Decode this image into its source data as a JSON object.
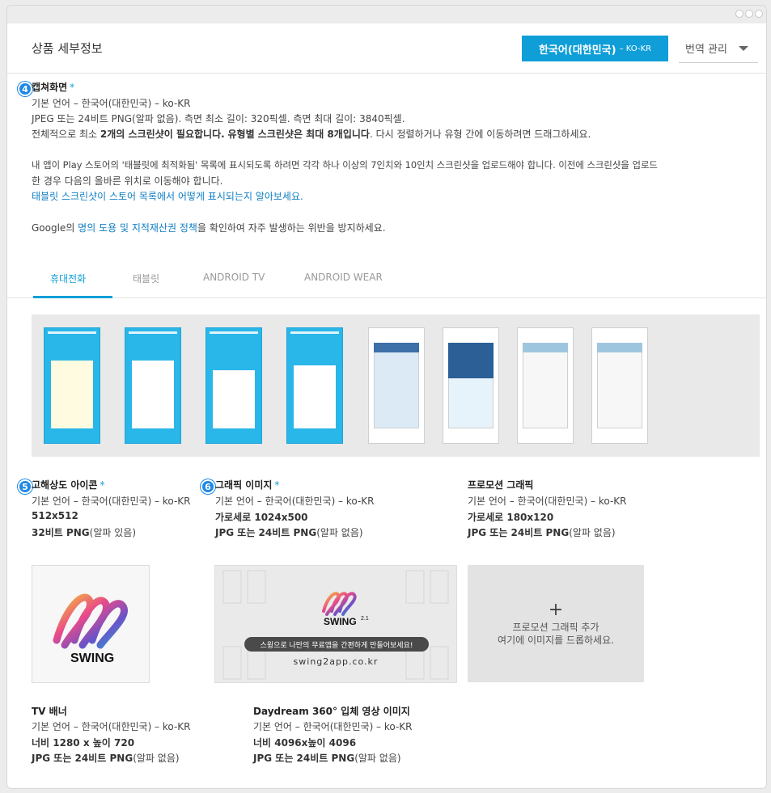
{
  "window": {
    "controls": [
      "dot-1",
      "dot-2",
      "dot-3"
    ]
  },
  "header": {
    "title": "상품 세부정보",
    "language_button": {
      "label": "한국어(대한민국)",
      "code": "– KO-KR"
    },
    "translate_label": "번역 관리"
  },
  "screenshots": {
    "badge": "4",
    "title": "캡쳐화면",
    "required_mark": "*",
    "default_lang": "기본 언어 – 한국어(대한민국) – ko-KR",
    "format": "JPEG 또는 24비트 PNG(알파 없음). 측면 최소 길이: 320픽셀. 측면 최대 길이: 3840픽셀.",
    "rule_prefix": "전체적으로 최소 ",
    "rule_bold1": "2개의 스크린샷이 필요합니다.",
    "rule_mid": " ",
    "rule_bold2": "유형별 스크린샷은 최대 8개입니다",
    "rule_suffix": ". 다시 정렬하거나 유형 간에 이동하려면 드래그하세요.",
    "tablet_p1": "내 앱이 Play 스토어의 '태블릿에 최적화됨' 목록에 표시되도록 하려면 각각 하나 이상의 7인치와 10인치 스크린샷을 업로드해야 합니다. 이전에 스크린샷을 업로드",
    "tablet_p2": "한 경우 다음의 올바른 위치로 이동해야 합니다.",
    "tablet_link": "태블릿 스크린샷이 스토어 목록에서 어떻게 표시되는지 알아보세요.",
    "google_prefix": "Google의 ",
    "google_link": "명의 도용 및 지적재산권 정책",
    "google_suffix": "을 확인하여 자주 발생하는 위반을 방지하세요."
  },
  "tabs": [
    {
      "label": "휴대전화",
      "active": true
    },
    {
      "label": "태블릿",
      "active": false
    },
    {
      "label": "ANDROID TV",
      "active": false
    },
    {
      "label": "ANDROID WEAR",
      "active": false
    }
  ],
  "hi_res_icon": {
    "badge": "5",
    "title": "고해상도 아이콘",
    "required_mark": "*",
    "lang": "기본 언어 – 한국어(대한민국) – ko-KR",
    "size": "512x512",
    "format_bold": "32비트 PNG",
    "format_rest": "(알파 있음)",
    "logo_text": "SWING"
  },
  "feature_graphic": {
    "badge": "6",
    "title": "그래픽 이미지",
    "required_mark": "*",
    "lang": "기본 언어 – 한국어(대한민국) – ko-KR",
    "size": "가로세로 1024x500",
    "format_bold": "JPG 또는 24비트 PNG",
    "format_rest": "(알파 없음)",
    "logo_text": "SWING",
    "version": "2.1",
    "tagline": "스윙으로 나만의 무료앱을 간편하게 만들어보세요!",
    "url": "swing2app.co.kr"
  },
  "promo_graphic": {
    "title": "프로모션 그래픽",
    "lang": "기본 언어 – 한국어(대한민국) – ko-KR",
    "size": "가로세로 180x120",
    "format_bold": "JPG 또는 24비트 PNG",
    "format_rest": "(알파 없음)",
    "add_plus": "+",
    "add_line1": "프로모션 그래픽 추가",
    "add_line2": "여기에 이미지를 드롭하세요."
  },
  "tv_banner": {
    "title": "TV 배너",
    "lang": "기본 언어 – 한국어(대한민국) – ko-KR",
    "size": "너비 1280 x 높이 720",
    "format_bold": "JPG 또는 24비트 PNG",
    "format_rest": "(알파 없음)"
  },
  "daydream": {
    "title": "Daydream 360° 입체 영상 이미지",
    "lang": "기본 언어 – 한국어(대한민국) – ko-KR",
    "size": "너비 4096x높이 4096",
    "format_bold": "JPG 또는 24비트 PNG",
    "format_rest": "(알파 없음)"
  },
  "colors": {
    "accent": "#0f9ed8",
    "badge": "#1e88e5",
    "link": "#0f7ec3"
  }
}
